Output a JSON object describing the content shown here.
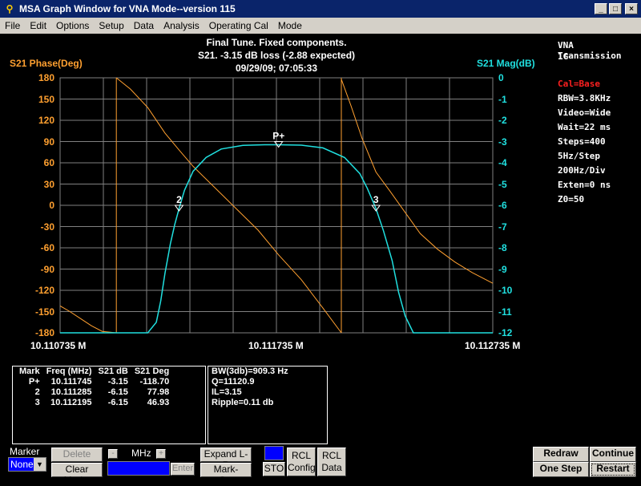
{
  "window": {
    "title": "MSA Graph Window for VNA Mode--version 115",
    "minimize": "_",
    "maximize": "□",
    "close": "×"
  },
  "menu": [
    "File",
    "Edit",
    "Options",
    "Setup",
    "Data",
    "Analysis",
    "Operating Cal",
    "Mode"
  ],
  "header": {
    "line1": "Final Tune. Fixed components.",
    "line2": "S21.   -3.15 dB loss (-2.88 expected)",
    "line3": "09/29/09; 07:05:33",
    "left_axis_title": "S21 Phase(Deg)",
    "right_axis_title": "S21 Mag(dB)"
  },
  "side_info": {
    "mode": "VNA Transmission",
    "band": "1G",
    "cal": "Cal=Base",
    "rbw": "RBW=3.8KHz",
    "video": "Video=Wide",
    "wait": "Wait=22 ms",
    "steps": "Steps=400",
    "hz_step": "5Hz/Step",
    "hz_div": "200Hz/Div",
    "exten": "Exten=0 ns",
    "z0": "Z0=50"
  },
  "colors": {
    "phase": "#ffa030",
    "mag": "#20e0e0",
    "grid": "#808080",
    "cal": "#ff2020",
    "background": "#000000"
  },
  "chart_data": {
    "type": "line",
    "xlabel": "",
    "x_ticks": [
      "10.110735 M",
      "10.111735 M",
      "10.112735 M"
    ],
    "xlim": [
      10.110735,
      10.112735
    ],
    "y_left": {
      "label": "S21 Phase(Deg)",
      "ticks": [
        "180",
        "150",
        "120",
        "90",
        "60",
        "30",
        "0",
        "-30",
        "-60",
        "-90",
        "-120",
        "-150",
        "-180"
      ],
      "lim": [
        -180,
        180
      ]
    },
    "y_right": {
      "label": "S21 Mag(dB)",
      "ticks": [
        "0",
        "-1",
        "-2",
        "-3",
        "-4",
        "-5",
        "-6",
        "-7",
        "-8",
        "-9",
        "-10",
        "-11",
        "-12"
      ],
      "lim": [
        -12,
        0
      ]
    },
    "grid": true,
    "series": [
      {
        "name": "S21 Mag(dB)",
        "axis": "right",
        "x": [
          10.110735,
          10.11102,
          10.11114,
          10.11118,
          10.1112,
          10.11122,
          10.111245,
          10.111265,
          10.111285,
          10.11131,
          10.11135,
          10.11141,
          10.11148,
          10.11158,
          10.11168,
          10.111745,
          10.11185,
          10.11195,
          10.11205,
          10.11212,
          10.112155,
          10.112195,
          10.11223,
          10.11227,
          10.1123,
          10.11233,
          10.112368,
          10.1124,
          10.112735
        ],
        "y": [
          -12,
          -12,
          -12,
          -11.5,
          -10.5,
          -9.2,
          -7.8,
          -6.9,
          -6.15,
          -5.3,
          -4.4,
          -3.75,
          -3.35,
          -3.18,
          -3.15,
          -3.15,
          -3.17,
          -3.3,
          -3.75,
          -4.5,
          -5.2,
          -6.15,
          -7.2,
          -8.6,
          -10.1,
          -11.2,
          -12,
          -12,
          -12
        ]
      },
      {
        "name": "S21 Phase(Deg)",
        "axis": "left",
        "segments": [
          {
            "x": [
              10.110735,
              10.11078,
              10.11083,
              10.11088,
              10.11093,
              10.110995
            ],
            "y": [
              -142,
              -150,
              -160,
              -170,
              -178,
              -180
            ]
          },
          {
            "x": [
              10.110995,
              10.110995
            ],
            "y": [
              -180,
              180
            ]
          },
          {
            "x": [
              10.110995,
              10.11106,
              10.11114,
              10.11122,
              10.111285,
              10.11135,
              10.11145,
              10.11155,
              10.11165,
              10.111745,
              10.11185,
              10.11195,
              10.112035
            ],
            "y": [
              180,
              164,
              138,
              102,
              77.98,
              55,
              25,
              -5,
              -35,
              -70,
              -105,
              -145,
              -180
            ]
          },
          {
            "x": [
              10.112035,
              10.112035
            ],
            "y": [
              -180,
              180
            ]
          },
          {
            "x": [
              10.112035,
              10.11208,
              10.11213,
              10.112195,
              10.11226,
              10.11233,
              10.1124,
              10.11248,
              10.11256,
              10.11264,
              10.112735
            ],
            "y": [
              178,
              140,
              95,
              46.93,
              20,
              -10,
              -40,
              -62,
              -80,
              -95,
              -110
            ]
          }
        ]
      }
    ],
    "markers": [
      {
        "label": "P+",
        "freq": 10.111745,
        "mag": -3.15
      },
      {
        "label": "2",
        "freq": 10.111285,
        "mag": -6.15
      },
      {
        "label": "3",
        "freq": 10.112195,
        "mag": -6.15
      }
    ]
  },
  "marker_table": {
    "headers": [
      "Mark",
      "Freq (MHz)",
      "S21 dB",
      "S21 Deg"
    ],
    "rows": [
      [
        "P+",
        "10.111745",
        "-3.15",
        "-118.70"
      ],
      [
        "2",
        "10.111285",
        "-6.15",
        "77.98"
      ],
      [
        "3",
        "10.112195",
        "-6.15",
        "46.93"
      ]
    ]
  },
  "analysis": {
    "bw": "BW(3db)=909.3 Hz",
    "q": "Q=11120.9",
    "il": "IL=3.15",
    "ripple": "Ripple=0.11 db"
  },
  "controls": {
    "marker_label": "Marker",
    "marker_value": "None",
    "delete": "Delete",
    "clear_marks": "Clear Marks",
    "minus": "-",
    "plus": "+",
    "mhz": "MHz",
    "enter": "Enter",
    "expand": "Expand L-R",
    "mark_cent": "Mark->Cent",
    "sto": "STO",
    "rcl_config": "RCL\nConfig",
    "rcl_data": "RCL\nData",
    "redraw": "Redraw",
    "continue": "Continue",
    "one_step": "One Step",
    "restart": "Restart"
  }
}
